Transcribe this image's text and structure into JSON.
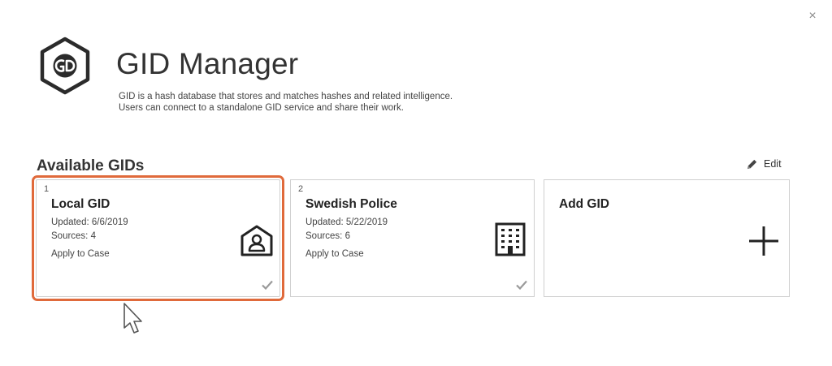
{
  "window": {
    "close_glyph": "×"
  },
  "header": {
    "title": "GID Manager",
    "description_lines": [
      "GID is a hash database that stores and matches hashes and related intelligence.",
      "Users can connect to a standalone GID service and share their work."
    ],
    "logo_icon": "gid-hexagon-logo"
  },
  "section": {
    "title": "Available GIDs",
    "edit_label": "Edit",
    "edit_icon": "pencil-icon"
  },
  "cards": [
    {
      "number": "1",
      "title": "Local GID",
      "updated": "Updated: 6/6/2019",
      "sources": "Sources: 4",
      "action": "Apply to Case",
      "icon": "home-user-icon",
      "selected": true,
      "checked": true
    },
    {
      "number": "2",
      "title": "Swedish Police",
      "updated": "Updated: 5/22/2019",
      "sources": "Sources: 6",
      "action": "Apply to Case",
      "icon": "building-icon",
      "selected": false,
      "checked": true
    }
  ],
  "add_card": {
    "title": "Add GID",
    "icon": "plus-icon"
  },
  "colors": {
    "accent": "#e06a3b",
    "border": "#cfcfcf",
    "text": "#333333"
  }
}
